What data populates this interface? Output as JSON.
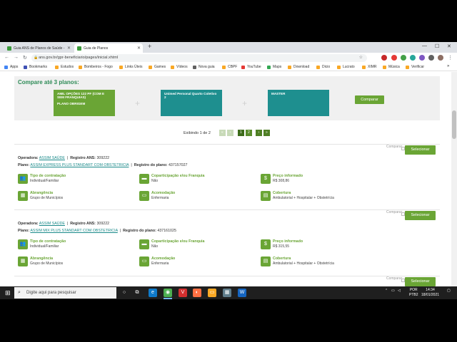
{
  "browser": {
    "tabs": [
      {
        "label": "Guia ANS de Planos de Saúde -",
        "active": false
      },
      {
        "label": "Guia de Planos",
        "active": true
      }
    ],
    "url": "ans.gov.br/gpr-beneficiario/pages/inicial.xhtml",
    "bookmarks": [
      "Apps",
      "Bookmarks",
      "Estudos",
      "Bombeiros - Fogo",
      "Links Úteis",
      "Games",
      "Vídeos",
      "Nova guia",
      "CBPF",
      "YouTube",
      "Maps",
      "Download",
      "Dicio",
      "Lucrato",
      "XIMR",
      "Música",
      "Verificar"
    ]
  },
  "compare": {
    "title": "Compare até 3 planos:",
    "slots": [
      {
        "name": "AMIL OPÇÕES 122 PF (COM E SEM FRANQUIAS)",
        "sub": "PLANO OBRIGEM"
      },
      {
        "name": "Unimed Personal Quarto Coletivo 2",
        "sub": ""
      },
      {
        "name": "MASTER",
        "sub": ""
      }
    ],
    "button": "Comparar"
  },
  "pager": {
    "text": "Exibindo 1 de 2",
    "first": "«",
    "prev": "‹",
    "pages": [
      "1",
      "2"
    ],
    "next": "›",
    "last": "»"
  },
  "labels": {
    "operadora": "Operadora:",
    "registro_ans": "Registro ANS:",
    "plano": "Plano:",
    "registro_plano": "Registro do plano:",
    "comparar": "Comparar",
    "selecionar": "Selecionar",
    "tipo": "Tipo de contratação",
    "coparticipacao": "Coparticipação e/ou Franquia",
    "preco": "Preço informado",
    "abrangencia": "Abrangência",
    "acomodacao": "Acomodação",
    "cobertura": "Cobertura"
  },
  "plans": [
    {
      "operadora": "ASSIM SAÚDE",
      "registro_ans": "309222",
      "plano": "ASSIM EXPRESS PLUS STANDART COM OBSTETRICIA",
      "registro_plano": "437157027",
      "tipo": "Individual/Familiar",
      "coparticipacao": "Não",
      "preco": "R$ 308,86",
      "abrangencia": "Grupo de Municípios",
      "acomodacao": "Enfermaria",
      "cobertura": "Ambulatorial + Hospitalar + Obstetrícia"
    },
    {
      "operadora": "ASSIM SAÚDE",
      "registro_ans": "309222",
      "plano": "ASSIM MIX PLUS STANDART COM OBSTETRICIA",
      "registro_plano": "437161025",
      "tipo": "Individual/Familiar",
      "coparticipacao": "Não",
      "preco": "R$ 315,55",
      "abrangencia": "Grupo de Municípios",
      "acomodacao": "Enfermaria",
      "cobertura": "Ambulatorial + Hospitalar + Obstetrícia"
    }
  ],
  "taskbar": {
    "search_placeholder": "Digite aqui para pesquisar",
    "lang": "POR",
    "lang2": "PTB2",
    "time": "14:34",
    "date": "18/01/2021"
  },
  "colors": {
    "accent": "#6aa535",
    "teal": "#1e8f8f"
  }
}
